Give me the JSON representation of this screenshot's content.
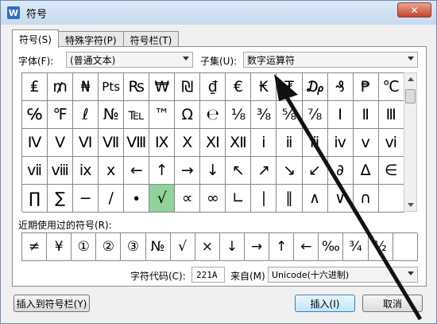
{
  "window": {
    "title": "符号",
    "app_icon": "W",
    "close_label": "✕"
  },
  "tabs": [
    {
      "label": "符号(S)"
    },
    {
      "label": "特殊字符(P)"
    },
    {
      "label": "符号栏(T)"
    }
  ],
  "font": {
    "label": "字体(F):",
    "value": "(普通文本)"
  },
  "subset": {
    "label": "子集(U):",
    "value": "数字运算符"
  },
  "symbols": [
    [
      "₤",
      "₥",
      "₦",
      "Pts",
      "₨",
      "₩",
      "₪",
      "₫",
      "€",
      "₭",
      "₮",
      "₯",
      "₰",
      "₱",
      "℃"
    ],
    [
      "℅",
      "℉",
      "ℓ",
      "№",
      "℡",
      "™",
      "Ω",
      "℮",
      "⅛",
      "⅜",
      "⅝",
      "⅞",
      "Ⅰ",
      "Ⅱ",
      "Ⅲ"
    ],
    [
      "Ⅳ",
      "Ⅴ",
      "Ⅵ",
      "Ⅶ",
      "Ⅷ",
      "Ⅸ",
      "Ⅹ",
      "Ⅺ",
      "Ⅻ",
      "ⅰ",
      "ⅱ",
      "ⅲ",
      "ⅳ",
      "ⅴ",
      "ⅵ"
    ],
    [
      "ⅶ",
      "ⅷ",
      "ⅸ",
      "ⅹ",
      "←",
      "↑",
      "→",
      "↓",
      "↖",
      "↗",
      "↘",
      "↙",
      "∂",
      "∆",
      "∈"
    ],
    [
      "∏",
      "∑",
      "−",
      "∕",
      "∙",
      "√",
      "∝",
      "∞",
      "∟",
      "∣",
      "∥",
      "∧",
      "∨",
      "∩",
      ""
    ]
  ],
  "selected_symbol": "√",
  "recent": {
    "label": "近期使用过的符号(R):",
    "items": [
      "≠",
      "¥",
      "①",
      "②",
      "③",
      "№",
      "√",
      "×",
      "↓",
      "→",
      "↑",
      "←",
      "‰",
      "¾",
      "½",
      ""
    ]
  },
  "charcode": {
    "label": "字符代码(C):",
    "value": "221A"
  },
  "from": {
    "label": "来自(M)",
    "value": "Unicode(十六进制)"
  },
  "buttons": {
    "insert_to_bar": "插入到符号栏(Y)",
    "insert": "插入(I)",
    "cancel": "取消"
  },
  "colors": {
    "selected": "#8fd29a",
    "title_bg": "#c7daf0",
    "close": "#c7432a"
  },
  "annotation": {
    "color": "#111111"
  }
}
